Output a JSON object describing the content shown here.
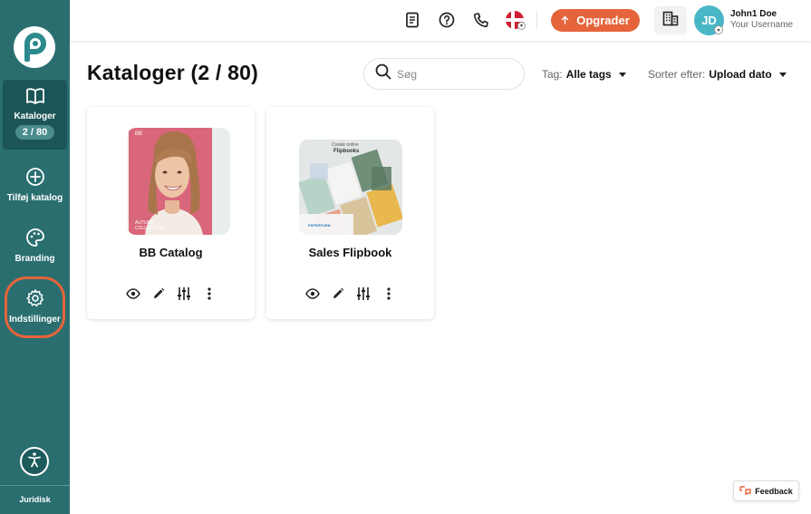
{
  "sidebar": {
    "logo_icon": "brand-logo-p",
    "items": [
      {
        "label": "Kataloger",
        "badge": "2 / 80",
        "icon": "book-open-icon",
        "active": true
      },
      {
        "label": "Tilføj katalog",
        "icon": "plus-circle-icon"
      },
      {
        "label": "Branding",
        "icon": "palette-icon"
      },
      {
        "label": "Indstillinger",
        "icon": "gear-icon"
      }
    ],
    "accessibility_icon": "accessibility-icon",
    "footer_link": "Juridisk"
  },
  "topbar": {
    "icons": [
      "document-icon",
      "help-icon",
      "phone-icon",
      "flag-dk-icon"
    ],
    "upgrade_label": "Opgrader",
    "org_icon": "building-icon",
    "avatar_initials": "JD",
    "user_name": "John1 Doe",
    "user_sub": "Your Username"
  },
  "main": {
    "title": "Kataloger (2 / 80)",
    "search_placeholder": "Søg",
    "tag_label": "Tag:",
    "tag_value": "Alle tags",
    "sort_label": "Sorter efter:",
    "sort_value": "Upload dato",
    "catalogs": [
      {
        "title": "BB Catalog",
        "cover_text_top": "BB",
        "cover_text_bottom": "AUTUMN COLLECTION"
      },
      {
        "title": "Sales Flipbook",
        "cover_text_top": "Create online",
        "cover_text_main": "Flipbooks",
        "cover_brand": "PAPERTURN"
      }
    ],
    "card_action_icons": [
      "eye-icon",
      "pencil-icon",
      "sliders-icon",
      "kebab-menu-icon"
    ]
  },
  "feedback_label": "Feedback",
  "colors": {
    "sidebar": "#2a6e70",
    "accent": "#e5643b",
    "avatar": "#49b6c6"
  }
}
